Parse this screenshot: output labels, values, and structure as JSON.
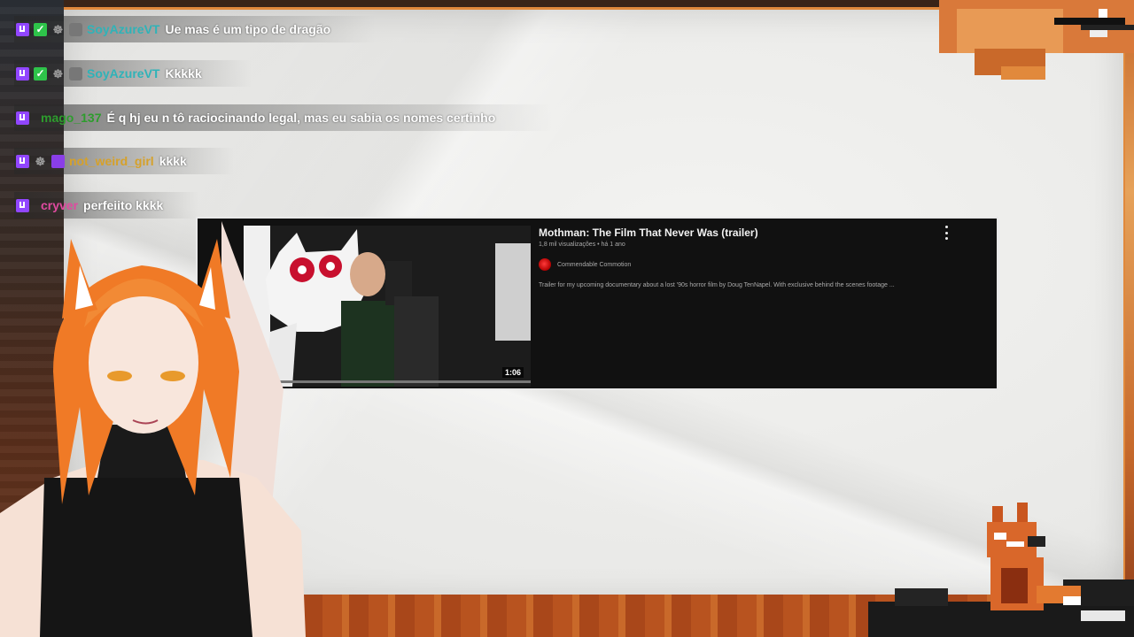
{
  "chat": {
    "messages": [
      {
        "user": "SoyAzureVT",
        "user_color": "#2fb3b8",
        "text": "Ue mas é um tipo de dragão",
        "badges": [
          "twitch-icon",
          "check-icon",
          "paw-icon",
          "mask-icon"
        ]
      },
      {
        "user": "SoyAzureVT",
        "user_color": "#2fb3b8",
        "text": "Kkkkk",
        "badges": [
          "twitch-icon",
          "check-icon",
          "paw-icon",
          "mask-icon"
        ]
      },
      {
        "user": "mago_137",
        "user_color": "#2d9d2d",
        "text": "É q hj eu n tô raciocinando legal, mas eu sabia os nomes certinho",
        "badges": [
          "twitch-icon"
        ]
      },
      {
        "user": "not_weird_girl",
        "user_color": "#d6a12a",
        "text": "kkkk",
        "badges": [
          "twitch-icon",
          "paw-icon",
          "purple-icon"
        ]
      },
      {
        "user": "cryver",
        "user_color": "#e04aa0",
        "text": "perfeiito kkkk",
        "badges": [
          "twitch-icon"
        ]
      }
    ]
  },
  "video": {
    "title": "Mothman: The Film That Never Was (trailer)",
    "meta": "1,8 mil visualizações • há 1 ano",
    "channel": "Commendable Commotion",
    "description": "Trailer for my upcoming documentary about a lost '90s horror film by Doug TenNapel. With exclusive behind the scenes footage ...",
    "duration": "1:06",
    "menu_icon": "more-vert-icon"
  },
  "colors": {
    "accent": "#e1893c",
    "card_bg": "#111111"
  }
}
